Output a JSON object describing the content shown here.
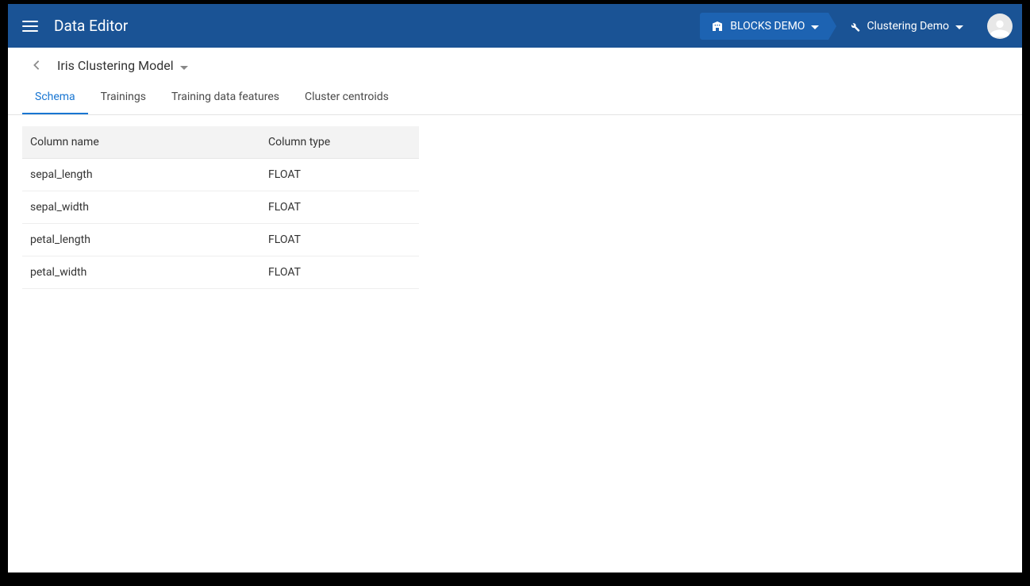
{
  "header": {
    "app_title": "Data Editor",
    "project_crumb": "BLOCKS DEMO",
    "sub_crumb": "Clustering Demo"
  },
  "subheader": {
    "model_title": "Iris Clustering Model"
  },
  "tabs": [
    {
      "label": "Schema",
      "active": true
    },
    {
      "label": "Trainings",
      "active": false
    },
    {
      "label": "Training data features",
      "active": false
    },
    {
      "label": "Cluster centroids",
      "active": false
    }
  ],
  "table": {
    "headers": {
      "col1": "Column name",
      "col2": "Column type"
    },
    "rows": [
      {
        "name": "sepal_length",
        "type": "FLOAT"
      },
      {
        "name": "sepal_width",
        "type": "FLOAT"
      },
      {
        "name": "petal_length",
        "type": "FLOAT"
      },
      {
        "name": "petal_width",
        "type": "FLOAT"
      }
    ]
  }
}
